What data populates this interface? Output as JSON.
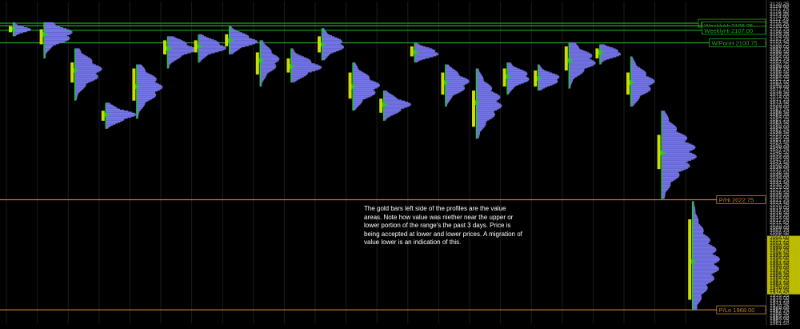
{
  "colors": {
    "background": "#000000",
    "profile": "#7777ee",
    "poc": "#22cc22",
    "value_area": "#ccdd00",
    "green_level": "#22aa22",
    "gold_level": "#b8862b",
    "axis_text": "#bbbbbb",
    "highlight": "#bbbb00"
  },
  "annotation": {
    "text": "The gold bars left side of the profiles are the value areas. Note how value was niether near the upper or lower portion of the range's the past 3 days. Price is being accepted at lower and lower prices. A migration of value lower is an indication of this."
  },
  "chart_data": {
    "type": "market_profile",
    "ylim": [
      1961.25,
      2121.25
    ],
    "y_axis_ticks": [
      "2120.25",
      "2119.00",
      "2117.75",
      "2116.50",
      "2115.25",
      "2114.00",
      "2112.75",
      "2111.50",
      "2110.25",
      "2109.00",
      "2107.75",
      "2106.50",
      "2105.25",
      "2104.00",
      "2102.75",
      "2101.50",
      "2100.25",
      "2099.00",
      "2097.75",
      "2096.50",
      "2095.25",
      "2094.00",
      "2092.75",
      "2091.50",
      "2090.25",
      "2089.00",
      "2087.75",
      "2086.50",
      "2085.25",
      "2084.00",
      "2082.75",
      "2081.50",
      "2080.25",
      "2079.00",
      "2077.75",
      "2076.50",
      "2075.25",
      "2074.00",
      "2072.75",
      "2071.50",
      "2070.25",
      "2069.00",
      "2067.75",
      "2066.50",
      "2065.25",
      "2064.00",
      "2062.75",
      "2061.50",
      "2060.25",
      "2059.00",
      "2057.75",
      "2056.50",
      "2055.25",
      "2054.00",
      "2052.75",
      "2051.50",
      "2050.25",
      "2049.00",
      "2047.75",
      "2046.50",
      "2045.25",
      "2044.00",
      "2042.75",
      "2041.50",
      "2040.25",
      "2039.00",
      "2037.75",
      "2036.50",
      "2035.25",
      "2034.00",
      "2032.75",
      "2031.50",
      "2030.25",
      "2029.00",
      "2027.75",
      "2026.50",
      "2025.25",
      "2024.00",
      "2022.75",
      "2021.50",
      "2020.25",
      "2019.00",
      "2017.75",
      "2016.50",
      "2015.25",
      "2014.00",
      "2012.75",
      "2011.50",
      "2010.25",
      "2009.00",
      "2007.75",
      "2006.50",
      "2005.25",
      "2004.00",
      "2002.75",
      "2001.50",
      "2000.25",
      "1999.00",
      "1997.75",
      "1996.50",
      "1995.25",
      "1994.00",
      "1992.75",
      "1991.50",
      "1990.25",
      "1989.00",
      "1987.75",
      "1986.50",
      "1985.25",
      "1984.00",
      "1982.75",
      "1981.50",
      "1980.25",
      "1979.00",
      "1977.75",
      "1976.50",
      "1975.25",
      "1974.00",
      "1972.75",
      "1971.50",
      "1970.25",
      "1969.00",
      "1967.75",
      "1966.50",
      "1965.25",
      "1964.00",
      "1962.75",
      "1961.50"
    ],
    "highlight_range": [
      1976.5,
      2004.0
    ],
    "levels": [
      {
        "label": "MonthVPOC 2110.50",
        "value": 2110.5,
        "color": "green"
      },
      {
        "label": "WeeklyHi 2109.25",
        "value": 2109.25,
        "color": "green"
      },
      {
        "label": "WeeklyHi 2107.00",
        "value": 2107.0,
        "color": "green"
      },
      {
        "label": "W/PonH 2100.75",
        "value": 2100.75,
        "color": "green"
      },
      {
        "label": "P/Hi 2022.75",
        "value": 2022.75,
        "color": "gold"
      },
      {
        "label": "P/Lo 1968.00",
        "value": 1968.0,
        "color": "gold"
      }
    ],
    "profiles": [
      {
        "high": 2111.0,
        "low": 2104.0,
        "poc": 2107.5,
        "va_high": 2109.0,
        "va_low": 2106.0,
        "max_width": 22
      },
      {
        "high": 2111.0,
        "low": 2093.0,
        "poc": 2105.0,
        "va_high": 2107.5,
        "va_low": 2100.0,
        "max_width": 38
      },
      {
        "high": 2098.0,
        "low": 2072.0,
        "poc": 2087.0,
        "va_high": 2091.0,
        "va_low": 2081.0,
        "max_width": 34
      },
      {
        "high": 2071.0,
        "low": 2058.0,
        "poc": 2065.0,
        "va_high": 2067.0,
        "va_low": 2062.0,
        "max_width": 38
      },
      {
        "high": 2090.0,
        "low": 2063.0,
        "poc": 2079.0,
        "va_high": 2088.0,
        "va_low": 2072.0,
        "max_width": 32
      },
      {
        "high": 2104.0,
        "low": 2088.0,
        "poc": 2098.0,
        "va_high": 2102.0,
        "va_low": 2095.0,
        "max_width": 36
      },
      {
        "high": 2105.0,
        "low": 2091.0,
        "poc": 2099.0,
        "va_high": 2102.0,
        "va_low": 2096.0,
        "max_width": 36
      },
      {
        "high": 2109.0,
        "low": 2095.0,
        "poc": 2102.0,
        "va_high": 2105.0,
        "va_low": 2099.0,
        "max_width": 36
      },
      {
        "high": 2102.0,
        "low": 2079.0,
        "poc": 2092.0,
        "va_high": 2096.0,
        "va_low": 2085.0,
        "max_width": 24
      },
      {
        "high": 2098.0,
        "low": 2081.0,
        "poc": 2089.0,
        "va_high": 2093.0,
        "va_low": 2086.0,
        "max_width": 38
      },
      {
        "high": 2108.0,
        "low": 2092.0,
        "poc": 2100.0,
        "va_high": 2104.0,
        "va_low": 2096.0,
        "max_width": 30
      },
      {
        "high": 2091.0,
        "low": 2067.0,
        "poc": 2079.0,
        "va_high": 2086.0,
        "va_low": 2073.0,
        "max_width": 34
      },
      {
        "high": 2077.0,
        "low": 2062.0,
        "poc": 2070.0,
        "va_high": 2073.0,
        "va_low": 2066.0,
        "max_width": 34
      },
      {
        "high": 2101.0,
        "low": 2091.0,
        "poc": 2096.0,
        "va_high": 2099.0,
        "va_low": 2094.0,
        "max_width": 34
      },
      {
        "high": 2090.0,
        "low": 2069.0,
        "poc": 2081.0,
        "va_high": 2086.0,
        "va_low": 2075.0,
        "max_width": 30
      },
      {
        "high": 2088.0,
        "low": 2053.0,
        "poc": 2071.0,
        "va_high": 2077.0,
        "va_low": 2059.0,
        "max_width": 32
      },
      {
        "high": 2091.0,
        "low": 2075.0,
        "poc": 2084.0,
        "va_high": 2088.0,
        "va_low": 2079.0,
        "max_width": 30
      },
      {
        "high": 2090.0,
        "low": 2077.0,
        "poc": 2083.0,
        "va_high": 2087.0,
        "va_low": 2079.0,
        "max_width": 30
      },
      {
        "high": 2101.0,
        "low": 2078.0,
        "poc": 2092.0,
        "va_high": 2099.0,
        "va_low": 2087.0,
        "max_width": 34
      },
      {
        "high": 2100.0,
        "low": 2090.0,
        "poc": 2096.0,
        "va_high": 2098.0,
        "va_low": 2093.0,
        "max_width": 30
      },
      {
        "high": 2094.0,
        "low": 2069.0,
        "poc": 2081.0,
        "va_high": 2086.0,
        "va_low": 2075.0,
        "max_width": 30
      },
      {
        "high": 2067.0,
        "low": 2023.0,
        "poc": 2046.0,
        "va_high": 2055.0,
        "va_low": 2038.0,
        "max_width": 44
      },
      {
        "high": 2022.0,
        "low": 1968.0,
        "poc": 1992.0,
        "va_high": 2013.0,
        "va_low": 1973.0,
        "max_width": 34
      }
    ]
  }
}
